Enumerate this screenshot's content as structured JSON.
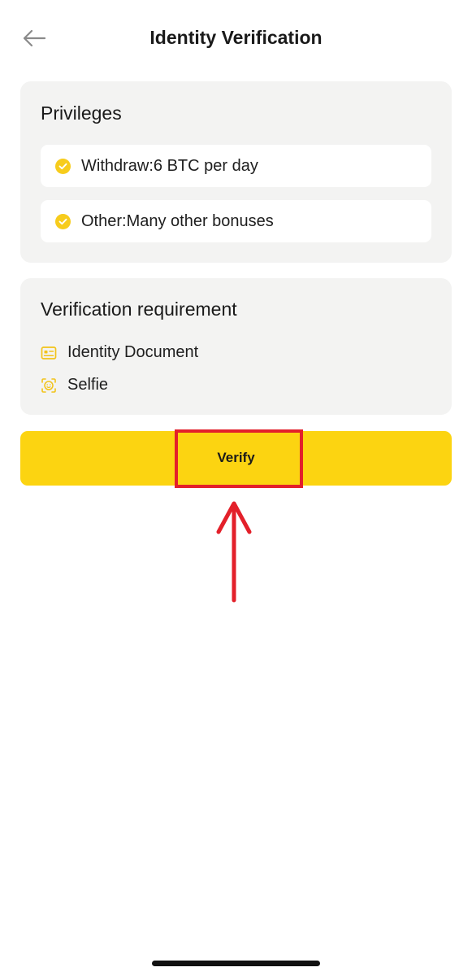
{
  "header": {
    "title": "Identity Verification",
    "back_icon": "arrow-left-icon"
  },
  "privileges": {
    "title": "Privileges",
    "items": [
      {
        "icon": "check-circle-icon",
        "label": "Withdraw:6 BTC per day"
      },
      {
        "icon": "check-circle-icon",
        "label": "Other:Many other bonuses"
      }
    ]
  },
  "requirements": {
    "title": "Verification requirement",
    "items": [
      {
        "icon": "id-card-icon",
        "label": "Identity Document"
      },
      {
        "icon": "face-scan-icon",
        "label": "Selfie"
      }
    ]
  },
  "verify_button": {
    "label": "Verify"
  },
  "annotation": {
    "highlight": "red-highlight-box",
    "arrow": "red-up-arrow"
  },
  "colors": {
    "accent": "#fcd411",
    "card_bg": "#f3f3f2",
    "icon_yellow": "#f7cc1c",
    "annotation_red": "#e3202a"
  }
}
